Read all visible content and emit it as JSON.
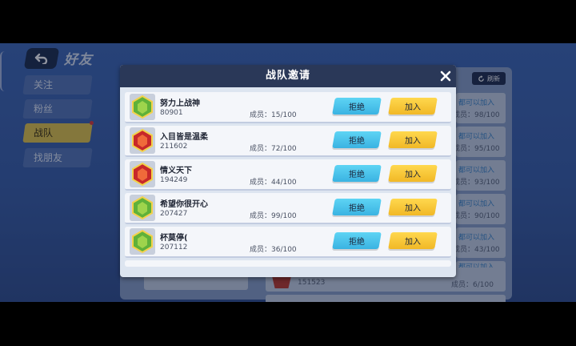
{
  "page": {
    "title": "好友"
  },
  "sidebar": {
    "items": [
      {
        "label": "关注"
      },
      {
        "label": "粉丝"
      },
      {
        "label": "战队"
      },
      {
        "label": "找朋友"
      }
    ]
  },
  "background": {
    "refresh_label": "刷新",
    "rows": [
      {
        "status": "都可以加入",
        "members": "成员：98/100"
      },
      {
        "status": "都可以加入",
        "members": "成员：95/100"
      },
      {
        "status": "都可以加入",
        "members": "成员：93/100"
      },
      {
        "status": "都可以加入",
        "members": "成员：90/100"
      },
      {
        "status": "都可以加入",
        "members": "成员：43/100"
      },
      {
        "status": "都可以加入",
        "members": ""
      }
    ],
    "bottom_row": {
      "id": "151523",
      "members": "成员：6/100"
    }
  },
  "modal": {
    "title": "战队邀请",
    "reject_label": "拒绝",
    "join_label": "加入",
    "teams": [
      {
        "name": "努力上战神",
        "id": "80901",
        "members": "成员：15/100",
        "badge_color": "green"
      },
      {
        "name": "入目皆是温柔",
        "id": "211602",
        "members": "成员：72/100",
        "badge_color": "red"
      },
      {
        "name": "情义天下",
        "id": "194249",
        "members": "成员：44/100",
        "badge_color": "red"
      },
      {
        "name": "希望你很开心",
        "id": "207427",
        "members": "成员：99/100",
        "badge_color": "green"
      },
      {
        "name": "杯莫停(",
        "id": "207112",
        "members": "成员：36/100",
        "badge_color": "green"
      }
    ]
  },
  "colors": {
    "reject": "#3ab3e2",
    "join": "#f1b826",
    "header": "#2a3858",
    "active_tab": "#e8c94a"
  }
}
